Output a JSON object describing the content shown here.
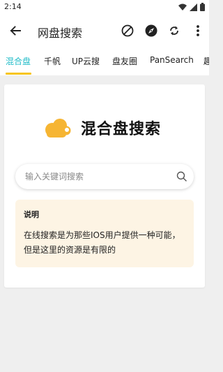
{
  "status_bar": {
    "time": "2:14"
  },
  "app_bar": {
    "title": "网盘搜索"
  },
  "tabs": [
    {
      "label": "混合盘",
      "active": true
    },
    {
      "label": "千帆",
      "active": false
    },
    {
      "label": "UP云搜",
      "active": false
    },
    {
      "label": "盘友圈",
      "active": false
    },
    {
      "label": "PanSearch",
      "active": false
    },
    {
      "label": "趣",
      "active": false
    }
  ],
  "card": {
    "brand_title": "混合盘搜索",
    "search": {
      "placeholder": "输入关键词搜索",
      "value": ""
    },
    "note": {
      "title": "说明",
      "text": "在线搜索是为那些IOS用户提供一种可能，但是这里的资源是有限的"
    }
  },
  "colors": {
    "tab_active": "#22bcc8",
    "indicator": "#f7c51b",
    "brand_icon": "#f6b533",
    "note_bg": "#fdf4e4"
  }
}
